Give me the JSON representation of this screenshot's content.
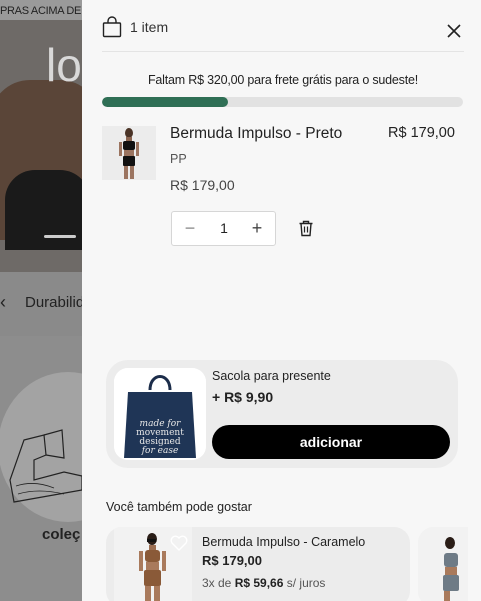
{
  "background": {
    "promo_text": "PRAS ACIMA DE",
    "hero_text": "lo",
    "strip_text": "Durabilid",
    "strip_arrow": "‹",
    "collection_caption": "coleç"
  },
  "cart": {
    "item_count": "1 item",
    "shipping_message": "Faltam R$ 320,00 para frete grátis para o sudeste!",
    "shipping_progress": 0.35,
    "progress_color": "#2f6f55",
    "item": {
      "name": "Bermuda Impulso - Preto",
      "price_total": "R$ 179,00",
      "size": "PP",
      "unit_price": "R$ 179,00",
      "quantity": "1",
      "minus": "−",
      "plus": "+"
    },
    "gift": {
      "title": "Sacola para presente",
      "price": "+ R$ 9,90",
      "button_label": "adicionar",
      "bag_text_1": "made for",
      "bag_text_2": "movement",
      "bag_text_3": "designed",
      "bag_text_4": "for ease"
    },
    "recommendations": {
      "heading": "Você também pode gostar",
      "items": [
        {
          "name": "Bermuda Impulso - Caramelo",
          "price": "R$ 179,00",
          "installments_prefix": "3x de ",
          "installments_value": "R$ 59,66",
          "installments_suffix": " s/ juros"
        }
      ]
    }
  }
}
